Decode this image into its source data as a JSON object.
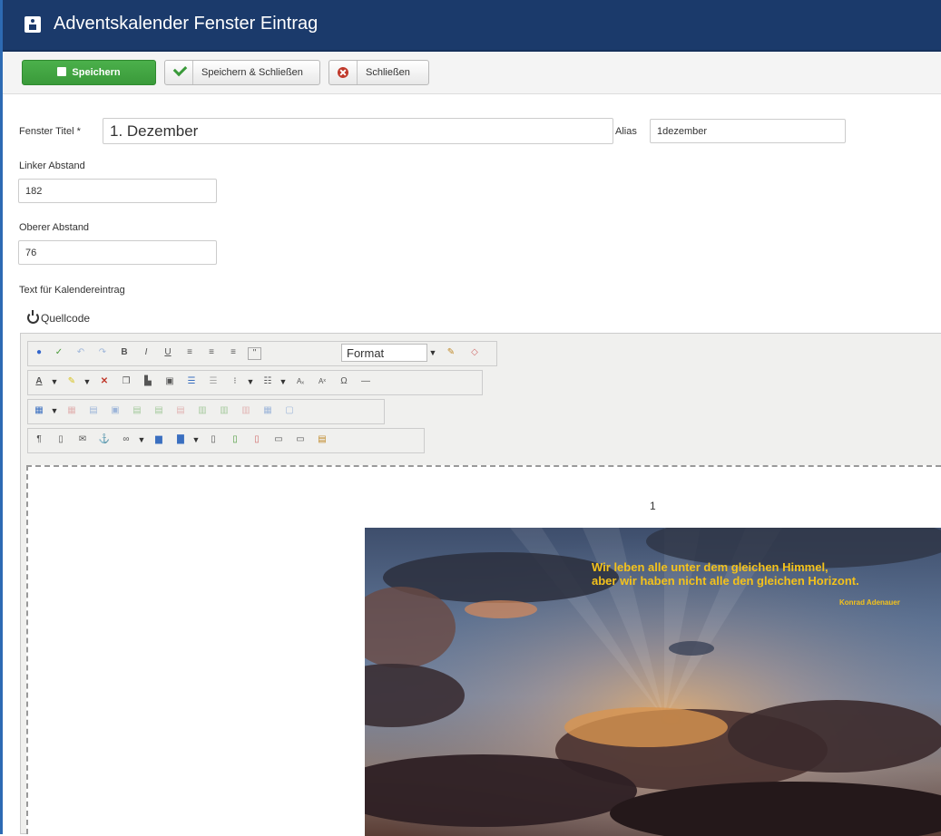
{
  "header": {
    "title": "Adventskalender Fenster Eintrag"
  },
  "toolbar": {
    "save_label": "Speichern",
    "save_close_label": "Speichern & Schließen",
    "close_label": "Schließen"
  },
  "form": {
    "fenster_titel_label": "Fenster Titel *",
    "fenster_titel_value": "1. Dezember",
    "alias_label": "Alias",
    "alias_value": "1dezember",
    "linker_abstand_label": "Linker Abstand",
    "linker_abstand_value": "182",
    "oberer_abstand_label": "Oberer Abstand",
    "oberer_abstand_value": "76",
    "text_label": "Text für Kalendereintrag",
    "source_toggle_label": "Quellcode"
  },
  "editor": {
    "format_select": "Format",
    "page_number": "1",
    "image_quote_line1": "Wir leben alle unter dem gleichen Himmel,",
    "image_quote_line2": "aber wir haben nicht alle den gleichen Horizont.",
    "image_quote_author": "Konrad Adenauer"
  },
  "colors": {
    "header_bg": "#1b3a6b",
    "save_button": "#3a9a3a",
    "quote_text": "#f4c21b"
  }
}
